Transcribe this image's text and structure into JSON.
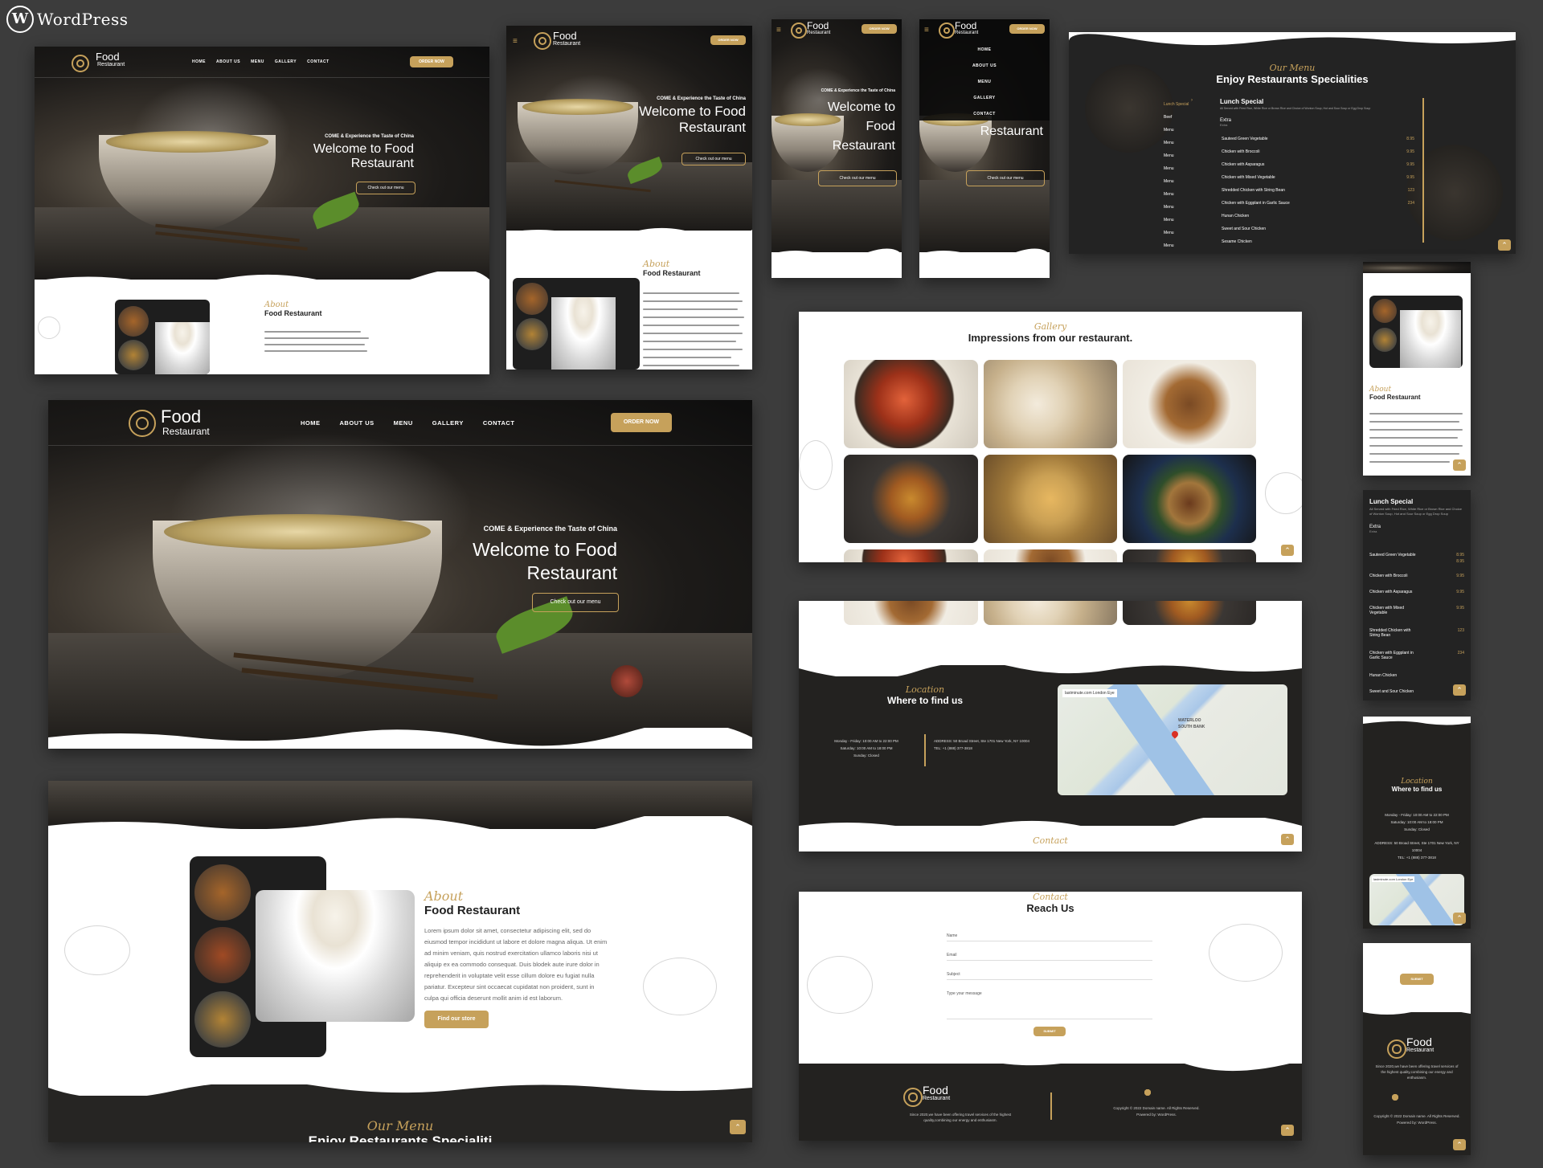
{
  "brand": {
    "wp_label": "WordPress",
    "name": "Food",
    "sub": "Restaurant"
  },
  "nav": {
    "home": "HOME",
    "about": "ABOUT US",
    "menu": "MENU",
    "gallery": "GALLERY",
    "contact": "CONTACT",
    "order": "ORDER NOW"
  },
  "hero": {
    "kicker": "COME & Experience the Taste of China",
    "title_1": "Welcome to Food",
    "title_2": "Restaurant",
    "cta": "Check out our menu"
  },
  "about": {
    "script": "About",
    "title": "Food Restaurant",
    "para": "Lorem ipsum dolor sit amet, consectetur adipiscing elit, sed do eiusmod tempor incididunt ut labore et dolore magna aliqua. Ut enim ad minim veniam, quis nostrud exercitation ullamco laboris nisi ut aliquip ex ea commodo consequat. Duis blodek aute irure dolor in reprehenderit in voluptate velit esse cillum dolore eu fugiat nulla pariatur. Excepteur sint occaecat cupidatat non proident, sunt in culpa qui officia deserunt mollit anim id est laborum.",
    "cta": "Find our store"
  },
  "menu": {
    "script": "Our Menu",
    "title": "Enjoy Restaurants Specialities",
    "title_partial": "Enjoy Restaurants Specialiti",
    "tabs": [
      "Lunch Special",
      "Beef",
      "Menu",
      "Menu",
      "Menu",
      "Menu",
      "Menu",
      "Menu",
      "Menu",
      "Menu",
      "Menu",
      "Menu"
    ],
    "section_title": "Lunch Special",
    "section_note": "All Served with Fried Rice, White Rice or Brown Rice and Choice of Wonton Soup, Hot and Sour Soup or Egg Drop Soup",
    "extra_label": "Extra",
    "extra_sub": "Extra",
    "items": [
      {
        "name": "Sauteed Green Vegetable",
        "price": "8.95"
      },
      {
        "name": "Chicken with Broccoli",
        "price": "9.95"
      },
      {
        "name": "Chicken with Asparagus",
        "price": "9.95"
      },
      {
        "name": "Chicken with Mixed Vegetable",
        "price": "9.95"
      },
      {
        "name": "Shredded Chicken with String Bean",
        "price": "123"
      },
      {
        "name": "Chicken with Eggplant in Garlic Sauce",
        "price": "234"
      },
      {
        "name": "Hunan Chicken",
        "price": ""
      },
      {
        "name": "Sweet and Sour Chicken",
        "price": ""
      },
      {
        "name": "Sesame Chicken",
        "price": ""
      }
    ],
    "mobile_prices": [
      "8.95",
      "8.95",
      "9.95",
      "9.95",
      "9.95",
      "123",
      "234"
    ]
  },
  "gallery": {
    "script": "Gallery",
    "title": "Impressions from our restaurant."
  },
  "location": {
    "script": "Location",
    "title": "Where to find us",
    "hours_1": "Monday - Friday: 10:00 AM to 22:00 PM",
    "hours_2": "Saturday: 10:00 AM to 18:00 PM",
    "hours_3": "Sunday: Closed",
    "address": "ADDRESS: 50 Broad Street, Ste 1701 New York, NY 10004",
    "tel": "TEL: +1 (888) 377-3818",
    "map_place": "lastminute.com London Eye",
    "map_district": "SOUTH BANK",
    "map_district2": "WATERLOO"
  },
  "contact": {
    "script": "Contact",
    "title": "Reach Us",
    "name_ph": "Name",
    "email_ph": "Email",
    "subject_ph": "Subject",
    "message_ph": "Type your message",
    "submit": "SUBMIT"
  },
  "footer": {
    "blurb": "Since 2020,we have been offering travel services of the highest quality,combining our energy and enthusiasm.",
    "copyright": "Copyright © 2022 Domain name. All Rights Reserved.",
    "powered": "Powered by: WordPress."
  },
  "icons": {
    "scroll_top": "chevron-up-icon",
    "hamburger": "hamburger-icon",
    "social": [
      "facebook-icon",
      "twitter-icon",
      "instagram-icon",
      "yelp-icon"
    ]
  },
  "colors": {
    "gold": "#c6a15b",
    "dark": "#1f1f1f",
    "canvas": "#3c3c3c"
  }
}
